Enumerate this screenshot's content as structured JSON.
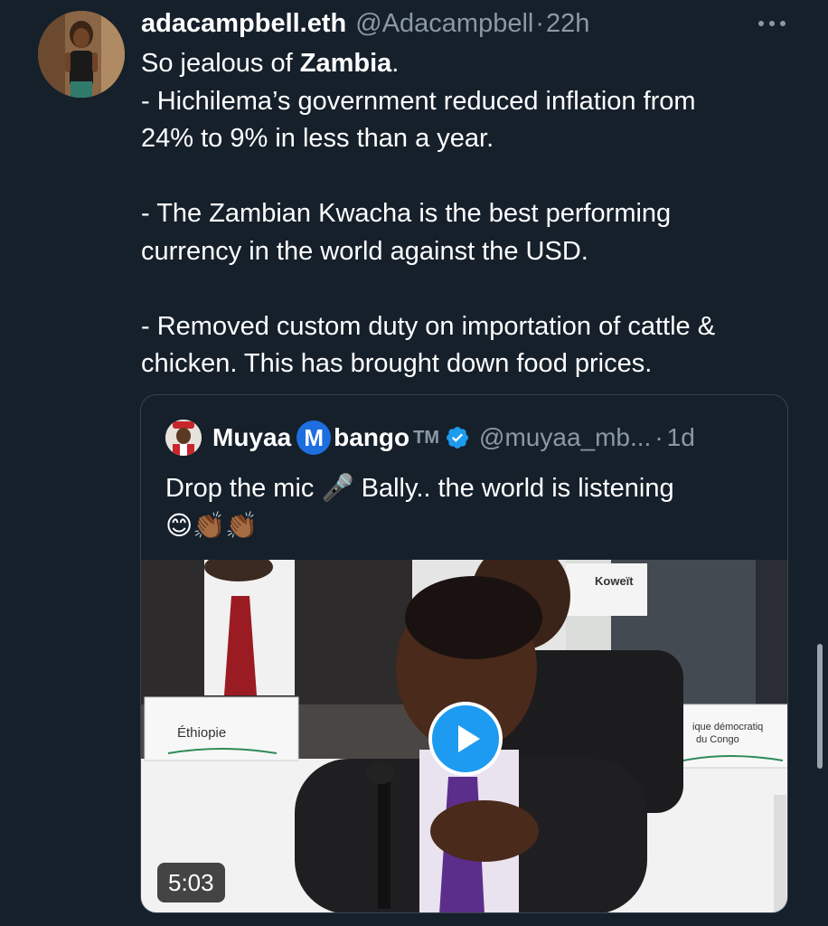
{
  "tweet": {
    "display_name": "adacampbell.eth",
    "handle": "@Adacampbell",
    "separator": "·",
    "time": "22h",
    "text": {
      "line1_prefix": "So jealous of ",
      "line1_bold": "Zambia",
      "line1_suffix": ".",
      "line2": "- Hichilema’s government reduced inflation from",
      "line3": "24% to 9% in less than a year.",
      "line4": "- The Zambian Kwacha is the best performing",
      "line5": "currency in the world against the USD.",
      "line6": "- Removed custom duty on importation of cattle &",
      "line7": "chicken. This has brought down food prices."
    }
  },
  "quoted_tweet": {
    "name_part1": "Muyaa",
    "badge_letter": "M",
    "name_part2": "bango",
    "trademark": "TM",
    "handle": "@muyaa_mb...",
    "separator": "·",
    "time": "1d",
    "text_line1": "Drop the mic 🎤 Bally.. the world is listening",
    "text_line2": "😊👏🏾👏🏾",
    "video": {
      "duration": "5:03",
      "placard_left": "Éthiopie",
      "placard_right_line1": "ique démocratiq",
      "placard_right_line2": "du Congo",
      "placard_top": "Koweït"
    }
  },
  "colors": {
    "background": "#15202b",
    "secondary_text": "#8b98a5",
    "card_border": "#38444d",
    "accent_blue": "#1d9bf0"
  },
  "icons": [
    "more-icon",
    "verified-badge-icon",
    "play-icon"
  ]
}
